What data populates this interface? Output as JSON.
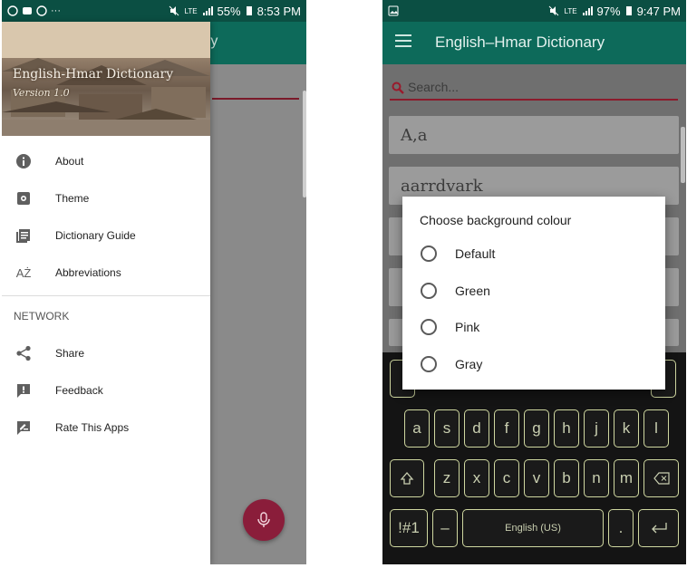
{
  "left_screen": {
    "status_bar": {
      "battery": "55%",
      "time": "8:53 PM",
      "network": "LTE"
    },
    "background_title_fragment": "ry",
    "drawer": {
      "title": "English-Hmar Dictionary",
      "version": "Version 1.0",
      "items": [
        {
          "label": "About",
          "icon": "info-icon"
        },
        {
          "label": "Theme",
          "icon": "settings-icon"
        },
        {
          "label": "Dictionary Guide",
          "icon": "book-icon"
        },
        {
          "label": "Abbreviations",
          "icon": "az-icon"
        }
      ],
      "section_label": "NETWORK",
      "network_items": [
        {
          "label": "Share",
          "icon": "share-icon"
        },
        {
          "label": "Feedback",
          "icon": "feedback-icon"
        },
        {
          "label": "Rate This Apps",
          "icon": "rate-icon"
        }
      ]
    },
    "fab_icon": "mic-icon",
    "colors": {
      "accent": "#8a1d3a",
      "primary": "#0d6a5a"
    }
  },
  "right_screen": {
    "status_bar": {
      "battery": "97%",
      "time": "9:47 PM",
      "network": "LTE"
    },
    "app_title": "English–Hmar Dictionary",
    "search_placeholder": "Search...",
    "words": [
      "A,a",
      "aarrdvark"
    ],
    "dialog": {
      "title": "Choose background colour",
      "options": [
        "Default",
        "Green",
        "Pink",
        "Gray"
      ]
    },
    "keyboard": {
      "row2": [
        "a",
        "s",
        "d",
        "f",
        "g",
        "h",
        "j",
        "k",
        "l"
      ],
      "row3": [
        "z",
        "x",
        "c",
        "v",
        "b",
        "n",
        "m"
      ],
      "symbols_key": "!#1",
      "dash_key": "–",
      "space_label": "English (US)",
      "period_key": "."
    }
  }
}
